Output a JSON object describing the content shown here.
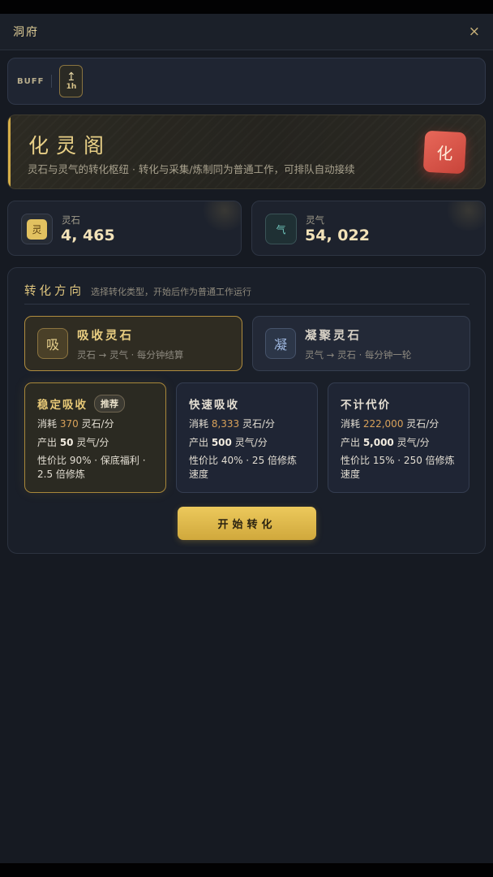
{
  "header": {
    "title": "洞府",
    "close_icon": "×"
  },
  "buff": {
    "label": "BUFF",
    "chip_icon": "↥",
    "chip_time": "1h"
  },
  "banner": {
    "title": "化灵阁",
    "subtitle": "灵石与灵气的转化枢纽 · 转化与采集/炼制同为普通工作，可排队自动接续",
    "badge": "化",
    "accent": "#d6ae48"
  },
  "stats": [
    {
      "label": "灵石",
      "value": "4, 465",
      "icon": "灵"
    },
    {
      "label": "灵气",
      "value": "54, 022",
      "icon": "气"
    }
  ],
  "conversion": {
    "title": "转化方向",
    "hint": "选择转化类型，开始后作为普通工作运行",
    "directions": [
      {
        "icon": "吸",
        "name": "吸收灵石",
        "desc": "灵石 → 灵气 · 每分钟结算",
        "active": true
      },
      {
        "icon": "凝",
        "name": "凝聚灵石",
        "desc": "灵气 → 灵石 · 每分钟一轮",
        "active": false
      }
    ],
    "modes": [
      {
        "name": "稳定吸收",
        "tag": "推荐",
        "cost_prefix": "消耗 ",
        "cost_value": "370",
        "cost_suffix": " 灵石/分",
        "out_prefix": "产出 ",
        "out_value": "50",
        "out_suffix": " 灵气/分",
        "efficiency": "性价比 90% · 保底福利 · 2.5 倍修炼"
      },
      {
        "name": "快速吸收",
        "tag": "",
        "cost_prefix": "消耗 ",
        "cost_value": "8,333",
        "cost_suffix": " 灵石/分",
        "out_prefix": "产出 ",
        "out_value": "500",
        "out_suffix": " 灵气/分",
        "efficiency": "性价比 40% · 25 倍修炼速度"
      },
      {
        "name": "不计代价",
        "tag": "",
        "cost_prefix": "消耗 ",
        "cost_value": "222,000",
        "cost_suffix": " 灵石/分",
        "out_prefix": "产出 ",
        "out_value": "5,000",
        "out_suffix": " 灵气/分",
        "efficiency": "性价比 15% · 250 倍修炼速度"
      }
    ],
    "start_label": "开始转化"
  }
}
